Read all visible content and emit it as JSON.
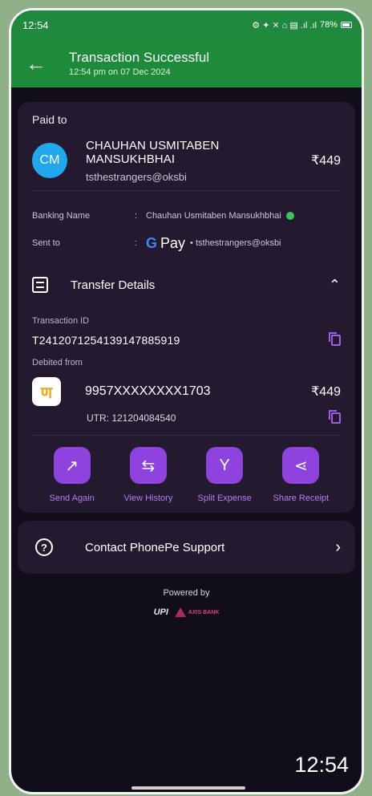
{
  "status_bar": {
    "time": "12:54",
    "icons_text": "⚙ ✦ ✕ ⌂ ▤ .ıl .ıl",
    "battery": "78%"
  },
  "header": {
    "back_icon": "←",
    "title": "Transaction Successful",
    "subtitle": "12:54 pm on 07 Dec 2024"
  },
  "paid_to": {
    "label": "Paid to",
    "initials": "CM",
    "name": "CHAUHAN USMITABEN MANSUKHBHAI",
    "upi": "tsthestrangers@oksbi",
    "amount": "₹449",
    "banking_label": "Banking Name",
    "colon": ":",
    "banking_name": "Chauhan Usmitaben Mansukhbhai",
    "sent_label": "Sent to",
    "gpay_text": "Pay",
    "sent_to": "• tsthestrangers@oksbi"
  },
  "transfer": {
    "title": "Transfer Details",
    "txn_label": "Transaction ID",
    "txn_id": "T2412071254139147885919",
    "debited_label": "Debited from",
    "bank_logo_text": "ण",
    "account": "9957XXXXXXXX1703",
    "amount": "₹449",
    "utr": "UTR: 121204084540"
  },
  "actions": [
    {
      "label": "Send Again",
      "icon": "↗"
    },
    {
      "label": "View History",
      "icon": "⇆"
    },
    {
      "label": "Split Expense",
      "icon": "Y"
    },
    {
      "label": "Share Receipt",
      "icon": "⋖"
    }
  ],
  "support": {
    "label": "Contact PhonePe Support",
    "icon": "?",
    "chevron": "›"
  },
  "footer": {
    "powered_by": "Powered by",
    "upi_logo": "UPI",
    "bank_logo_text": "AXIS BANK"
  },
  "overlay_clock": "12:54",
  "colors": {
    "header_green": "#1e8b3b",
    "accent_purple": "#8f43de",
    "card": "#231a30",
    "background": "#120d1b"
  }
}
